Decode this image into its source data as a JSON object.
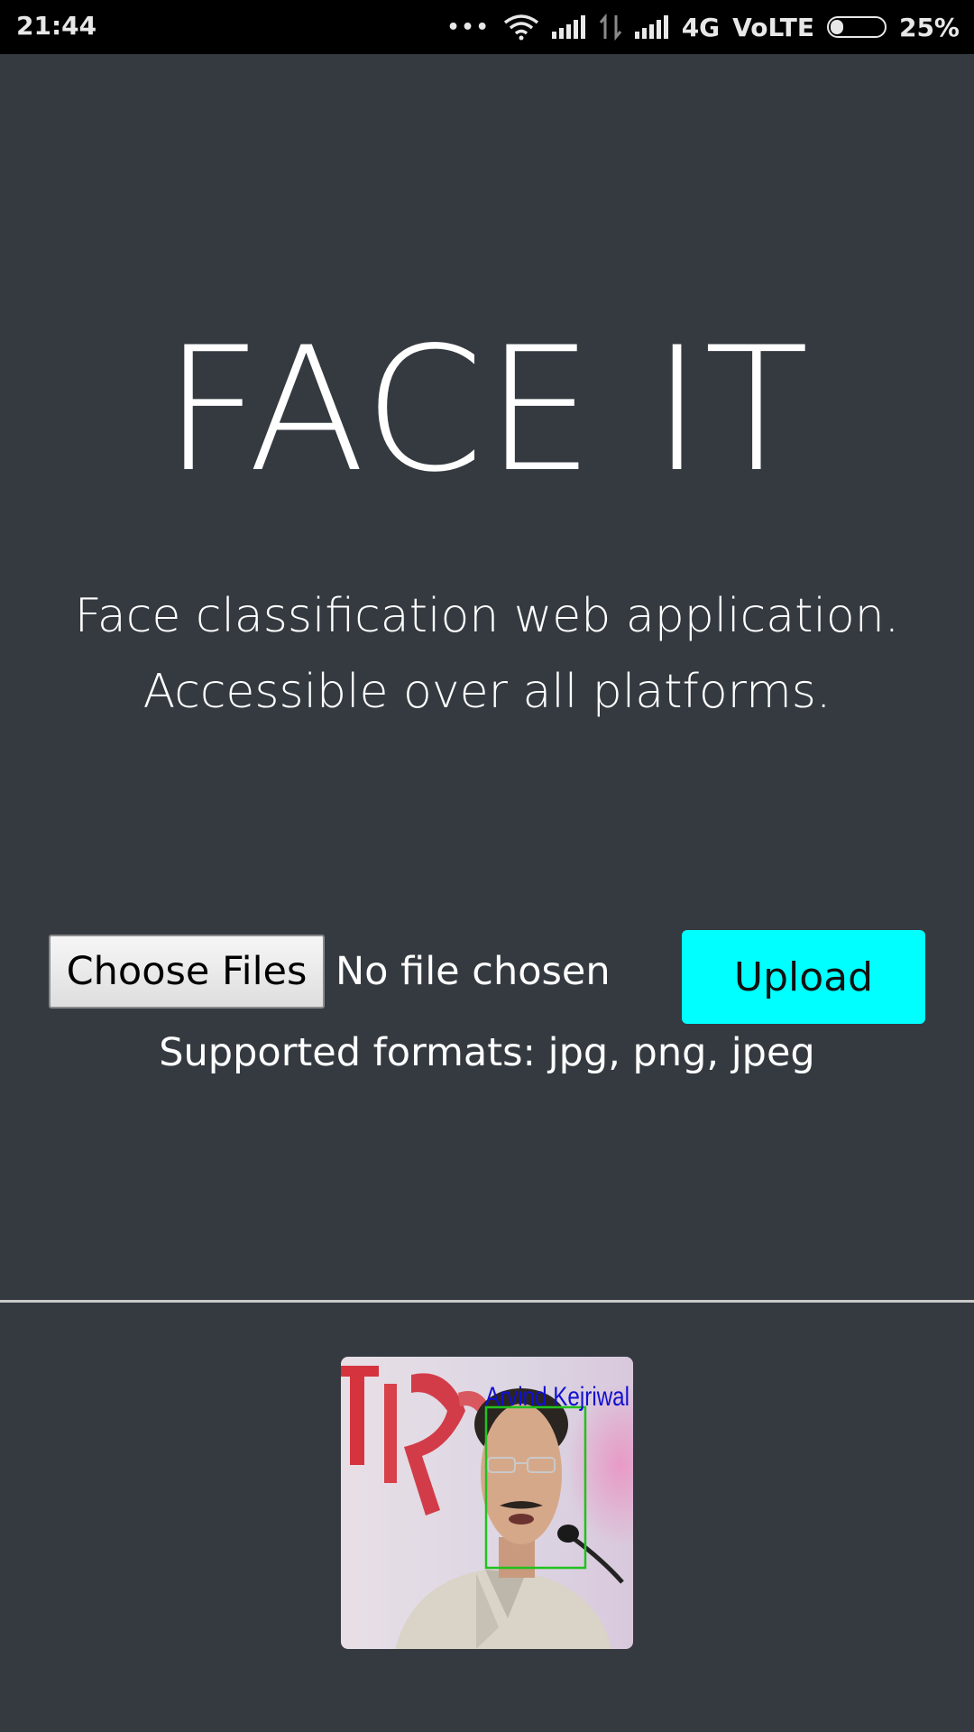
{
  "status_bar": {
    "time": "21:44",
    "dots": "•••",
    "network": "4G",
    "volte": "VoLTE",
    "battery_percent": "25%",
    "battery_level": 0.25,
    "icons": [
      "wifi-icon",
      "signal-icon",
      "data-arrows-icon",
      "signal-icon",
      "battery-icon"
    ]
  },
  "hero": {
    "title": "FACE IT",
    "subtitle_line1": "Face classification web application.",
    "subtitle_line2": "Accessible over all platforms."
  },
  "upload_form": {
    "choose_files_label": "Choose Files",
    "file_status": "No file chosen",
    "upload_label": "Upload",
    "supported_formats": "Supported formats: jpg, png, jpeg"
  },
  "result": {
    "detected_name": "Arvind Kejriwal",
    "box_color": "#22c11e",
    "label_color": "#1010d0"
  },
  "colors": {
    "background": "#343a40",
    "accent": "#00ffff",
    "status_bar": "#000000"
  }
}
